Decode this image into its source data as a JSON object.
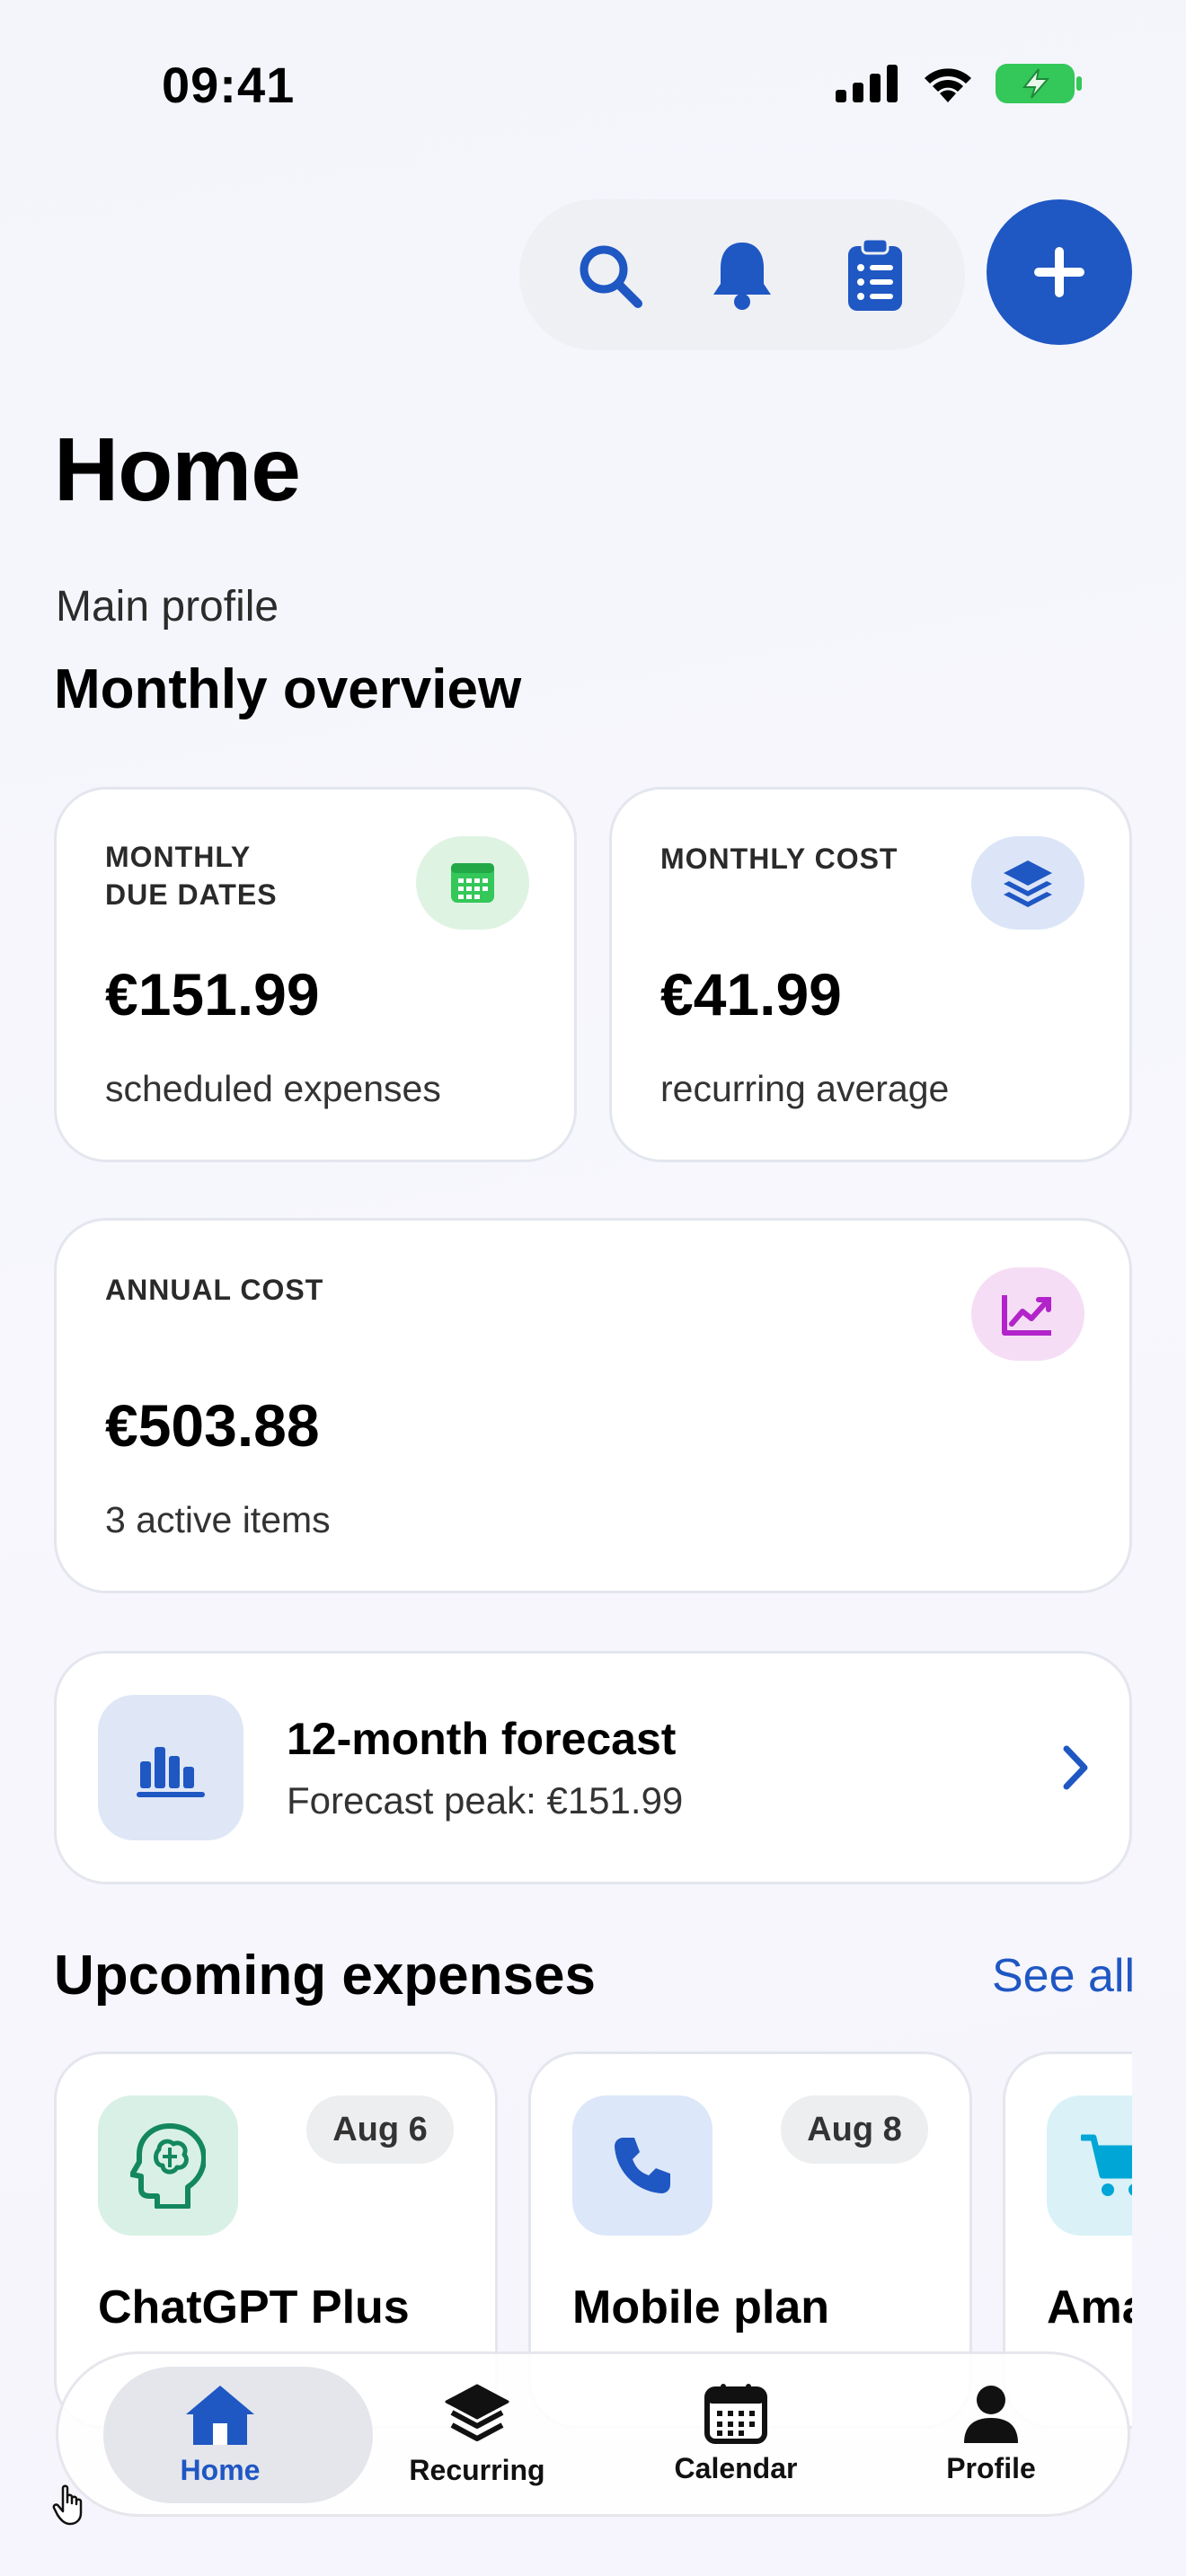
{
  "status_bar": {
    "time": "09:41"
  },
  "header": {
    "title": "Home",
    "profile": "Main profile",
    "section": "Monthly overview"
  },
  "cards": {
    "due": {
      "label_line1": "MONTHLY",
      "label_line2": "DUE DATES",
      "value": "€151.99",
      "sub": "scheduled expenses"
    },
    "monthly": {
      "label": "MONTHLY COST",
      "value": "€41.99",
      "sub": "recurring average"
    },
    "annual": {
      "label": "ANNUAL COST",
      "value": "€503.88",
      "sub": "3 active items"
    }
  },
  "forecast": {
    "title": "12-month forecast",
    "subtitle": "Forecast peak: €151.99"
  },
  "upcoming": {
    "title": "Upcoming expenses",
    "see_all": "See all",
    "items": [
      {
        "name": "ChatGPT Plus",
        "date": "Aug 6",
        "icon": "brain-icon"
      },
      {
        "name": "Mobile plan",
        "date": "Aug 8",
        "icon": "phone-icon"
      },
      {
        "name": "Ama",
        "date": "",
        "icon": "cart-icon"
      }
    ]
  },
  "tabs": [
    {
      "label": "Home",
      "icon": "home-icon",
      "active": true
    },
    {
      "label": "Recurring",
      "icon": "layers-icon",
      "active": false
    },
    {
      "label": "Calendar",
      "icon": "calendar-icon",
      "active": false
    },
    {
      "label": "Profile",
      "icon": "person-icon",
      "active": false
    }
  ],
  "colors": {
    "accent": "#1f57c3",
    "green": "#34c759",
    "purple": "#b224c9"
  }
}
